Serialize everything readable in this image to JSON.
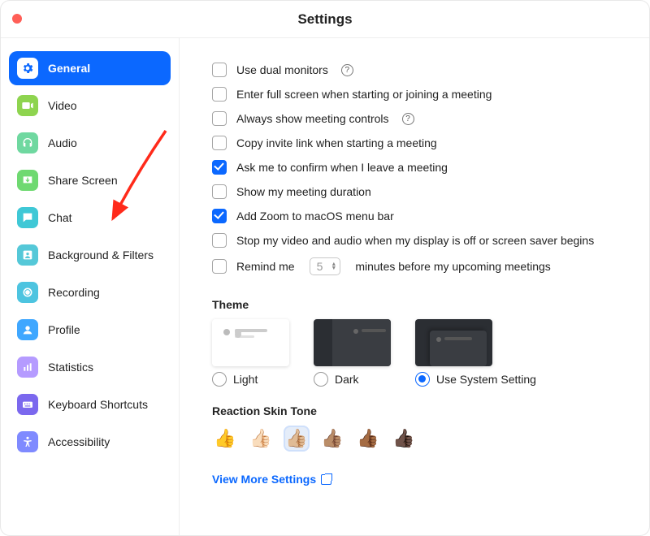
{
  "window_title": "Settings",
  "sidebar": {
    "active_index": 0,
    "items": [
      {
        "label": "General"
      },
      {
        "label": "Video"
      },
      {
        "label": "Audio"
      },
      {
        "label": "Share Screen"
      },
      {
        "label": "Chat"
      },
      {
        "label": "Background & Filters"
      },
      {
        "label": "Recording"
      },
      {
        "label": "Profile"
      },
      {
        "label": "Statistics"
      },
      {
        "label": "Keyboard Shortcuts"
      },
      {
        "label": "Accessibility"
      }
    ]
  },
  "options": {
    "dual_monitors": {
      "checked": false,
      "label": "Use dual monitors",
      "help": true
    },
    "enter_full_screen": {
      "checked": false,
      "label": "Enter full screen when starting or joining a meeting"
    },
    "always_show_controls": {
      "checked": false,
      "label": "Always show meeting controls",
      "help": true
    },
    "copy_invite": {
      "checked": false,
      "label": "Copy invite link when starting a meeting"
    },
    "confirm_leave": {
      "checked": true,
      "label": "Ask me to confirm when I leave a meeting"
    },
    "show_duration": {
      "checked": false,
      "label": "Show my meeting duration"
    },
    "add_to_menubar": {
      "checked": true,
      "label": "Add Zoom to macOS menu bar"
    },
    "stop_on_display_off": {
      "checked": false,
      "label": "Stop my video and audio when my display is off or screen saver begins"
    },
    "remind_me": {
      "checked": false,
      "label_before": "Remind me",
      "value": "5",
      "label_after": "minutes before my upcoming meetings"
    }
  },
  "theme": {
    "title": "Theme",
    "selected": "system",
    "light_label": "Light",
    "dark_label": "Dark",
    "system_label": "Use System Setting"
  },
  "skin_tone": {
    "title": "Reaction Skin Tone",
    "selected_index": 2,
    "tones": [
      "👍",
      "👍🏻",
      "👍🏼",
      "👍🏽",
      "👍🏾",
      "👍🏿"
    ]
  },
  "view_more": "View More Settings",
  "icon_colors": {
    "general": "#0b68ff",
    "video": "#8ed44f",
    "audio": "#6fd8a0",
    "share": "#6fd971",
    "chat": "#3fc8d6",
    "background": "#55c8d8",
    "recording": "#4dc4e0",
    "profile": "#3fa7ff",
    "statistics": "#b59bff",
    "keyboard": "#7b68ee",
    "accessibility": "#7f8aff"
  }
}
